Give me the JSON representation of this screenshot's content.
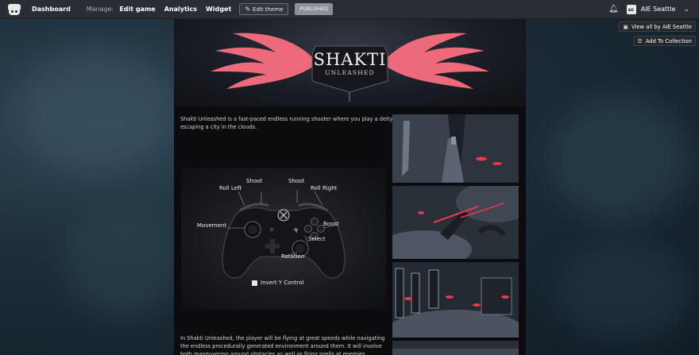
{
  "topbar": {
    "dashboard": "Dashboard",
    "manage_label": "Manage:",
    "edit_game": "Edit game",
    "analytics": "Analytics",
    "widget": "Widget",
    "edit_theme": "Edit theme",
    "published": "PUBLISHED",
    "avatar_text": "AIE",
    "user": "AIE Seattle"
  },
  "side": {
    "view_all": "View all by AIE Seattle",
    "add_collection": "Add To Collection"
  },
  "banner": {
    "title": "SHAKTI",
    "subtitle": "UNLEASHED"
  },
  "content": {
    "intro": "Shakti Unleashed is a fast-paced endless running shooter where you play a deity escaping a city in the clouds.",
    "description": "In Shakti Unleashed, the player will be flying at great speeds while navigating the endless procedurally generated environment around them. It will involve both maneuvering around obstacles as well as firing spells at enemies."
  },
  "controller": {
    "shoot_left": "Shoot",
    "shoot_right": "Shoot",
    "roll_left": "Roll Left",
    "roll_right": "Roll Right",
    "movement": "Movement",
    "boost": "Boost",
    "select": "Select",
    "rotation": "Rotation",
    "y_button": "Y",
    "invert": "Invert Y Control"
  },
  "colors": {
    "wing": "#ec6a79",
    "accent_red": "#e8374f",
    "topbar_bg": "#2a2d33"
  },
  "icons": {
    "logo": "itchio-logo-icon",
    "edit": "pencil-icon",
    "bell": "bell-icon",
    "chevron": "chevron-down-icon",
    "view_all": "avatar-icon",
    "add_collection": "add-to-collection-icon"
  }
}
